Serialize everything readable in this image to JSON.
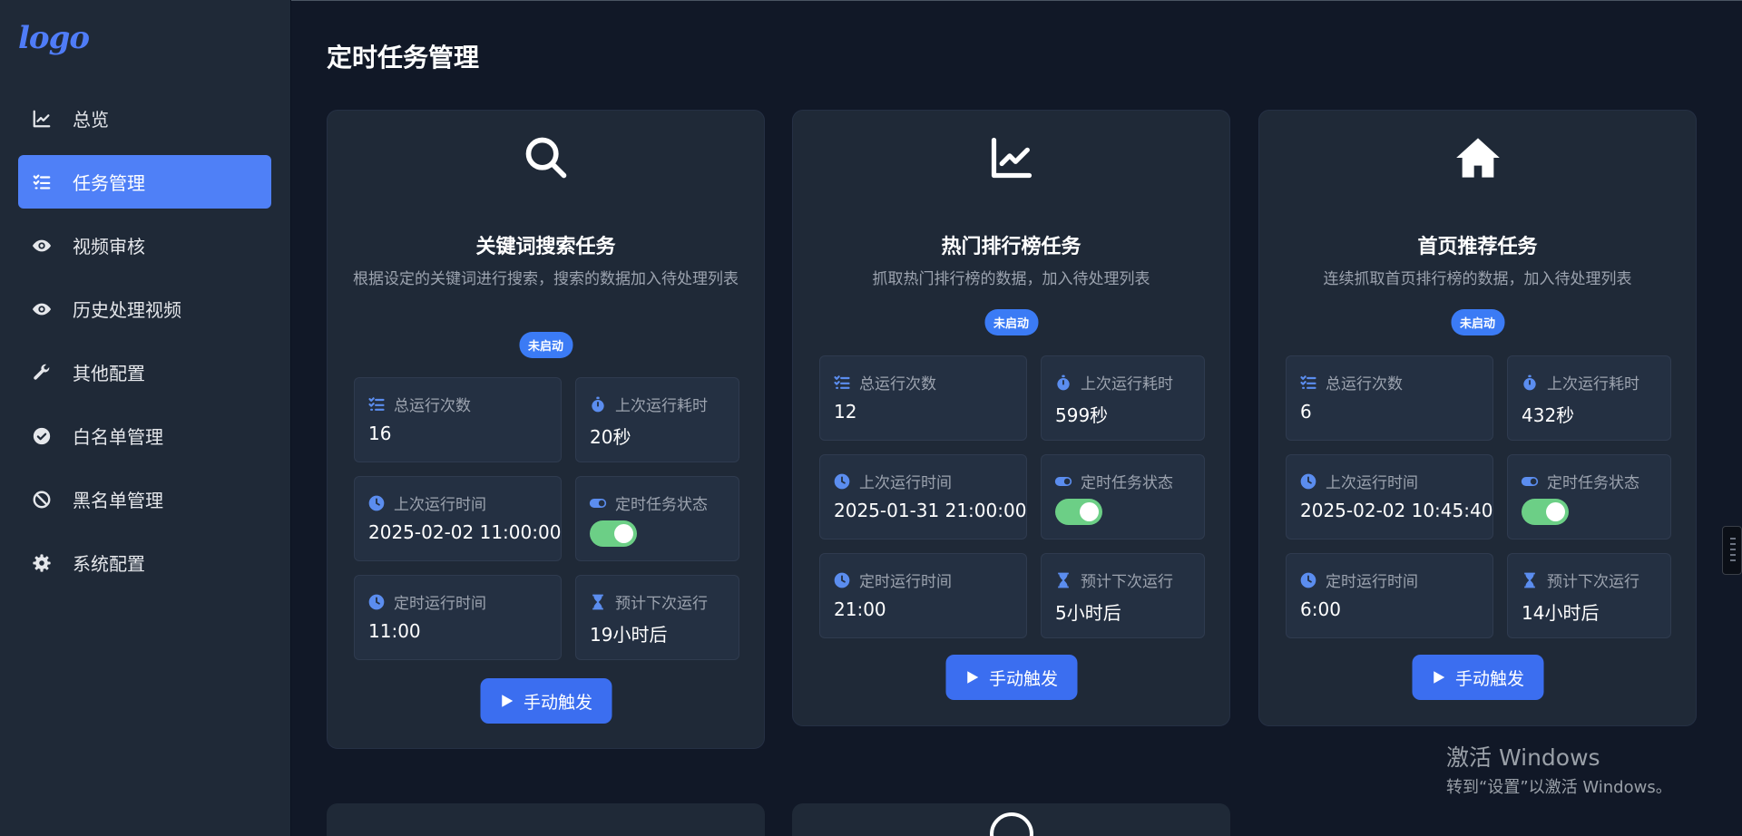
{
  "app": {
    "logo": "logo"
  },
  "sidebar": {
    "items": [
      {
        "label": "总览",
        "icon": "chart-line-icon",
        "active": false
      },
      {
        "label": "任务管理",
        "icon": "list-check-icon",
        "active": true
      },
      {
        "label": "视频审核",
        "icon": "eye-icon",
        "active": false
      },
      {
        "label": "历史处理视频",
        "icon": "eye-icon",
        "active": false
      },
      {
        "label": "其他配置",
        "icon": "wrench-icon",
        "active": false
      },
      {
        "label": "白名单管理",
        "icon": "check-circle-icon",
        "active": false
      },
      {
        "label": "黑名单管理",
        "icon": "ban-icon",
        "active": false
      },
      {
        "label": "系统配置",
        "icon": "gear-icon",
        "active": false
      }
    ]
  },
  "page": {
    "title": "定时任务管理"
  },
  "labels": {
    "total_runs": "总运行次数",
    "last_duration": "上次运行耗时",
    "last_run_time": "上次运行时间",
    "schedule_status": "定时任务状态",
    "scheduled_time": "定时运行时间",
    "next_run": "预计下次运行",
    "trigger": "手动触发"
  },
  "tasks": [
    {
      "icon": "search-icon",
      "title": "关键词搜索任务",
      "desc": "根据设定的关键词进行搜索，搜索的数据加入待处理列表",
      "status": "未启动",
      "total_runs": "16",
      "last_duration": "20秒",
      "last_run_time": "2025-02-02 11:00:00",
      "schedule_enabled": true,
      "scheduled_time": "11:00",
      "next_run": "19小时后"
    },
    {
      "icon": "chart-line-icon",
      "title": "热门排行榜任务",
      "desc": "抓取热门排行榜的数据，加入待处理列表",
      "status": "未启动",
      "total_runs": "12",
      "last_duration": "599秒",
      "last_run_time": "2025-01-31 21:00:00",
      "schedule_enabled": true,
      "scheduled_time": "21:00",
      "next_run": "5小时后"
    },
    {
      "icon": "home-icon",
      "title": "首页推荐任务",
      "desc": "连续抓取首页排行榜的数据，加入待处理列表",
      "status": "未启动",
      "total_runs": "6",
      "last_duration": "432秒",
      "last_run_time": "2025-02-02 10:45:40",
      "schedule_enabled": true,
      "scheduled_time": "6:00",
      "next_run": "14小时后"
    }
  ],
  "colors": {
    "accent": "#4f80f7",
    "badge": "#3b7bf5",
    "button": "#3b6ef0",
    "toggle_on": "#6ccf86",
    "icon_blue": "#5b8def"
  },
  "watermark": {
    "line1": "激活 Windows",
    "line2": "转到“设置”以激活 Windows。"
  }
}
